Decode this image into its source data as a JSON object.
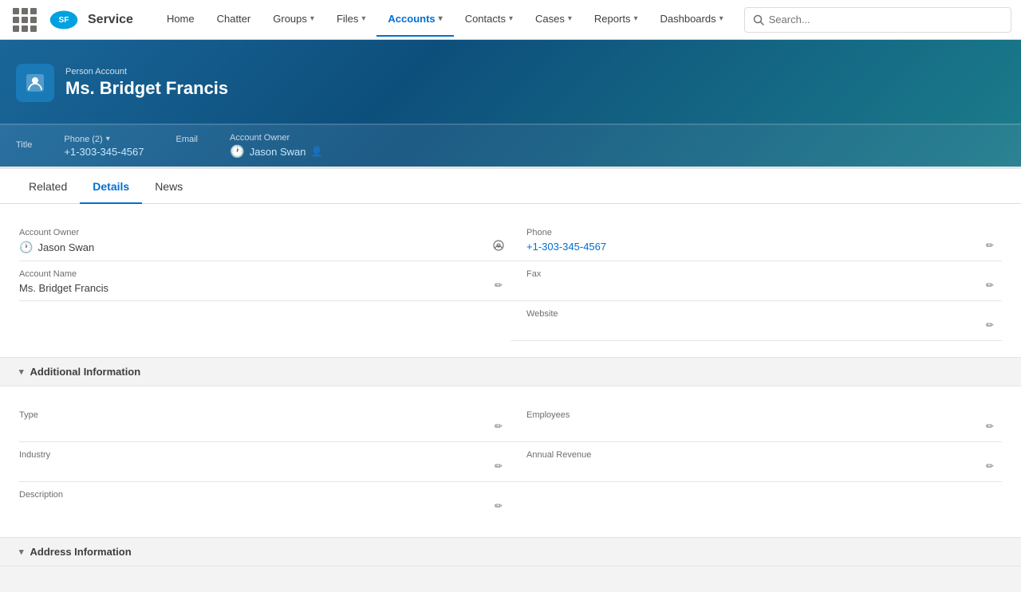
{
  "app": {
    "logo_alt": "Salesforce",
    "app_name": "Service"
  },
  "search": {
    "placeholder": "Search..."
  },
  "nav": {
    "items": [
      {
        "label": "Home",
        "has_dropdown": false,
        "active": false
      },
      {
        "label": "Chatter",
        "has_dropdown": false,
        "active": false
      },
      {
        "label": "Groups",
        "has_dropdown": true,
        "active": false
      },
      {
        "label": "Files",
        "has_dropdown": true,
        "active": false
      },
      {
        "label": "Accounts",
        "has_dropdown": true,
        "active": true
      },
      {
        "label": "Contacts",
        "has_dropdown": true,
        "active": false
      },
      {
        "label": "Cases",
        "has_dropdown": true,
        "active": false
      },
      {
        "label": "Reports",
        "has_dropdown": true,
        "active": false
      },
      {
        "label": "Dashboards",
        "has_dropdown": true,
        "active": false
      }
    ]
  },
  "record": {
    "type": "Person Account",
    "name": "Ms. Bridget Francis",
    "fields": {
      "title_label": "Title",
      "title_value": "",
      "phone_label": "Phone (2)",
      "phone_value": "+1-303-345-4567",
      "email_label": "Email",
      "email_value": "",
      "account_owner_label": "Account Owner",
      "account_owner_value": "Jason Swan"
    }
  },
  "tabs": [
    {
      "label": "Related",
      "active": false
    },
    {
      "label": "Details",
      "active": true
    },
    {
      "label": "News",
      "active": false
    }
  ],
  "details": {
    "section_main_label": "",
    "fields": [
      {
        "label": "Account Owner",
        "value": "Jason Swan",
        "is_link": true,
        "has_edit": false,
        "has_change": true,
        "col": "left"
      },
      {
        "label": "Phone",
        "value": "+1-303-345-4567",
        "is_link": true,
        "has_edit": true,
        "col": "right"
      },
      {
        "label": "Account Name",
        "value": "Ms. Bridget Francis",
        "is_link": false,
        "has_edit": true,
        "col": "left"
      },
      {
        "label": "Fax",
        "value": "",
        "is_link": false,
        "has_edit": true,
        "col": "right"
      },
      {
        "label": "",
        "value": "",
        "is_link": false,
        "has_edit": false,
        "col": "left"
      },
      {
        "label": "Website",
        "value": "",
        "is_link": false,
        "has_edit": true,
        "col": "right"
      }
    ],
    "additional_section": {
      "label": "Additional Information",
      "fields": [
        {
          "label": "Type",
          "value": "",
          "is_link": false,
          "has_edit": true,
          "col": "left"
        },
        {
          "label": "Employees",
          "value": "",
          "is_link": false,
          "has_edit": true,
          "col": "right"
        },
        {
          "label": "Industry",
          "value": "",
          "is_link": false,
          "has_edit": true,
          "col": "left"
        },
        {
          "label": "Annual Revenue",
          "value": "",
          "is_link": false,
          "has_edit": true,
          "col": "right"
        },
        {
          "label": "Description",
          "value": "",
          "is_link": false,
          "has_edit": true,
          "col": "left"
        },
        {
          "label": "",
          "value": "",
          "is_link": false,
          "has_edit": false,
          "col": "right"
        }
      ]
    },
    "address_section": {
      "label": "Address Information"
    }
  }
}
